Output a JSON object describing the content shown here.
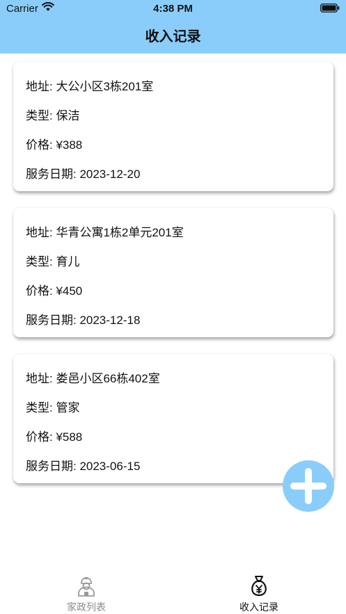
{
  "status_bar": {
    "carrier": "Carrier",
    "time": "4:38 PM"
  },
  "nav": {
    "title": "收入记录"
  },
  "records": [
    {
      "address": "地址: 大公小区3栋201室",
      "type": "类型: 保洁",
      "price": "价格: ¥388",
      "date": "服务日期: 2023-12-20"
    },
    {
      "address": "地址: 华青公寓1栋2单元201室",
      "type": "类型: 育儿",
      "price": "价格: ¥450",
      "date": "服务日期: 2023-12-18"
    },
    {
      "address": "地址: 娄邑小区66栋402室",
      "type": "类型: 管家",
      "price": "价格: ¥588",
      "date": "服务日期: 2023-06-15"
    }
  ],
  "tabs": [
    {
      "label": "家政列表",
      "icon": "worker-icon",
      "active": false
    },
    {
      "label": "收入记录",
      "icon": "money-bag-icon",
      "active": true
    }
  ],
  "colors": {
    "header_bg": "#8acdfa",
    "fab_bg": "#8acdfa",
    "tab_inactive": "#8a8a8a"
  }
}
